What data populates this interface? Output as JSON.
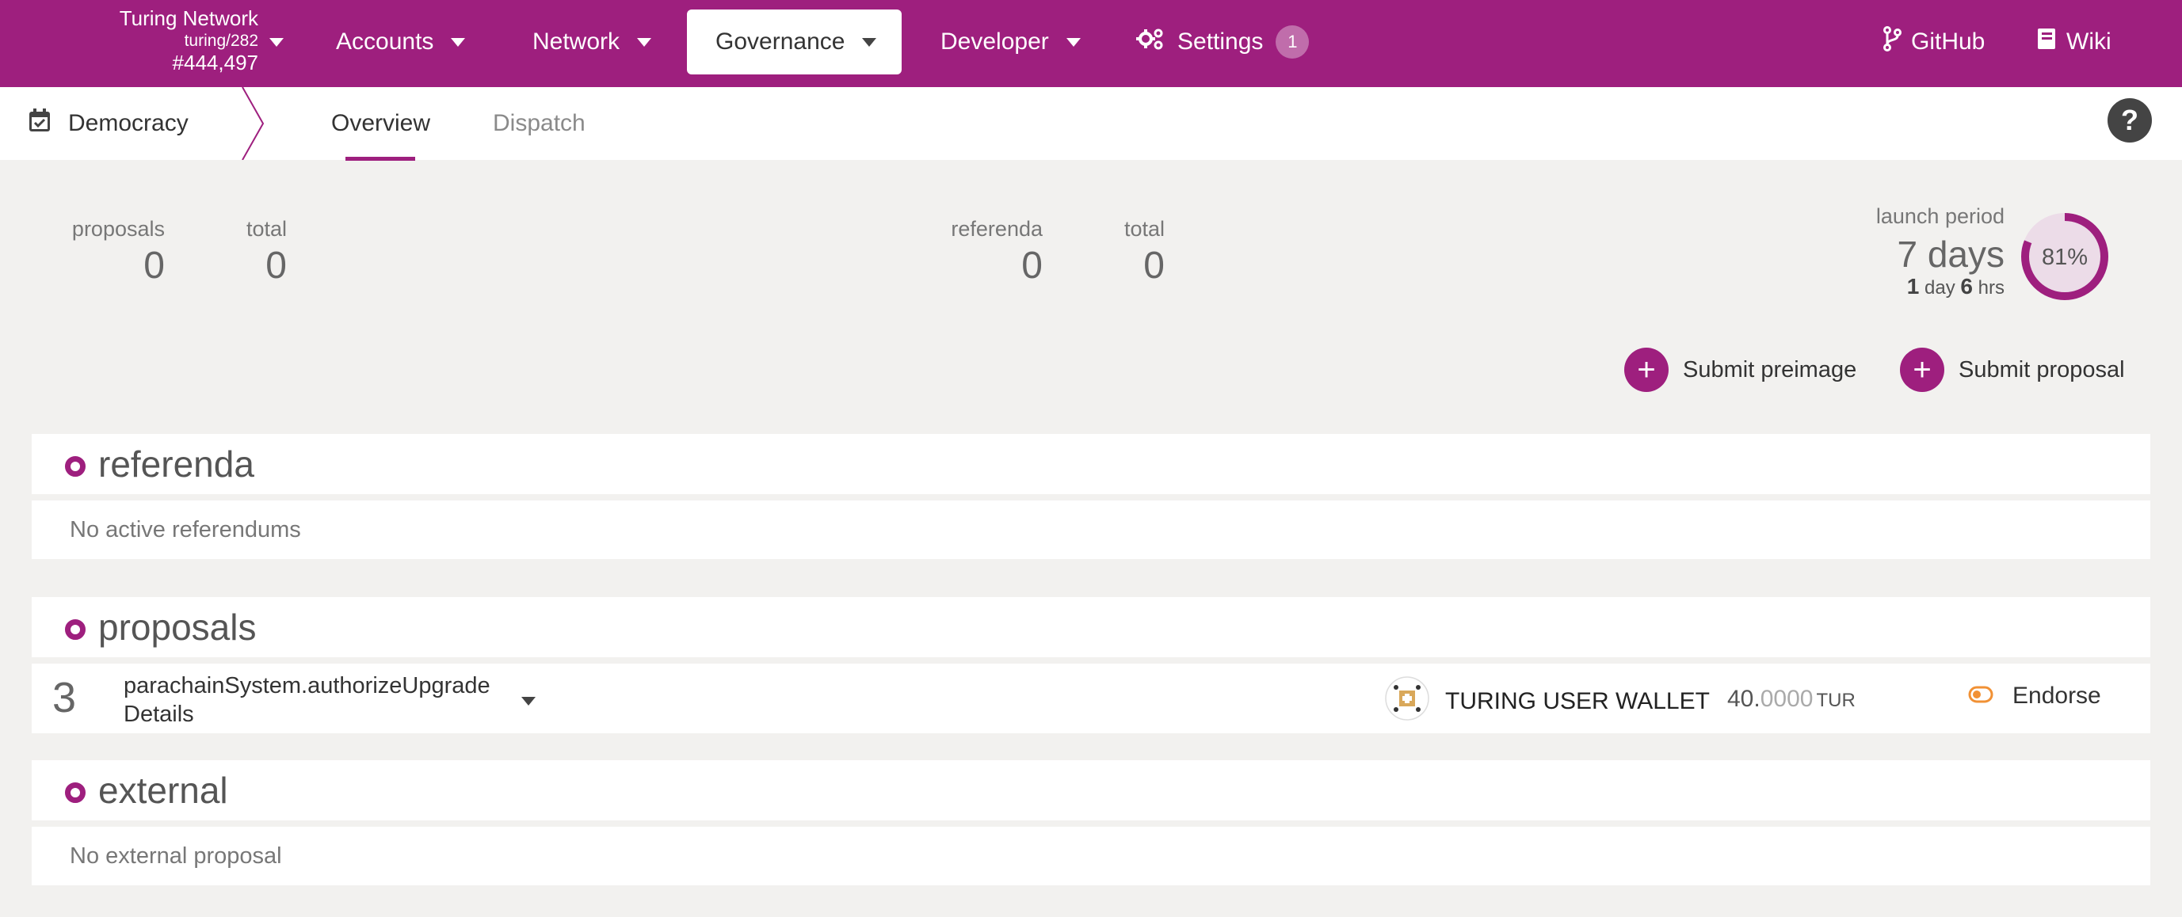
{
  "chain": {
    "name": "Turing Network",
    "spec": "turing/282",
    "block": "#444,497"
  },
  "nav": {
    "accounts": "Accounts",
    "network": "Network",
    "governance": "Governance",
    "developer": "Developer",
    "settings": "Settings",
    "settings_badge": "1",
    "github": "GitHub",
    "wiki": "Wiki"
  },
  "subnav": {
    "section": "Democracy",
    "tabs": [
      "Overview",
      "Dispatch"
    ],
    "help": "?"
  },
  "summary": {
    "proposals_label": "proposals",
    "proposals_value": "0",
    "proposals_total_label": "total",
    "proposals_total_value": "0",
    "referenda_label": "referenda",
    "referenda_value": "0",
    "referenda_total_label": "total",
    "referenda_total_value": "0",
    "launch_label": "launch period",
    "launch_value": "7 days",
    "launch_days_num": "1",
    "launch_days_unit": "day",
    "launch_hrs_num": "6",
    "launch_hrs_unit": "hrs",
    "launch_percent_text": "81%",
    "launch_percent": 0.81
  },
  "actions": {
    "submit_preimage": "Submit preimage",
    "submit_proposal": "Submit proposal"
  },
  "sections": {
    "referenda_title": "referenda",
    "referenda_empty": "No active referendums",
    "proposals_title": "proposals",
    "external_title": "external",
    "external_empty": "No external proposal"
  },
  "proposal": {
    "index": "3",
    "call": "parachainSystem.authorizeUpgrade",
    "details": "Details",
    "account": "TURING USER WALLET",
    "amount_int": "40.",
    "amount_dec": "0000",
    "amount_unit": "TUR",
    "endorse": "Endorse"
  },
  "colors": {
    "brand": "#9e1f7e",
    "endorse_icon": "#f19135"
  },
  "icons": {
    "calendar": "calendar-check-icon",
    "settings": "cogs-icon",
    "github": "code-branch-icon",
    "wiki": "book-icon",
    "help": "question-circle-icon",
    "endorse": "toggle-off-icon"
  }
}
